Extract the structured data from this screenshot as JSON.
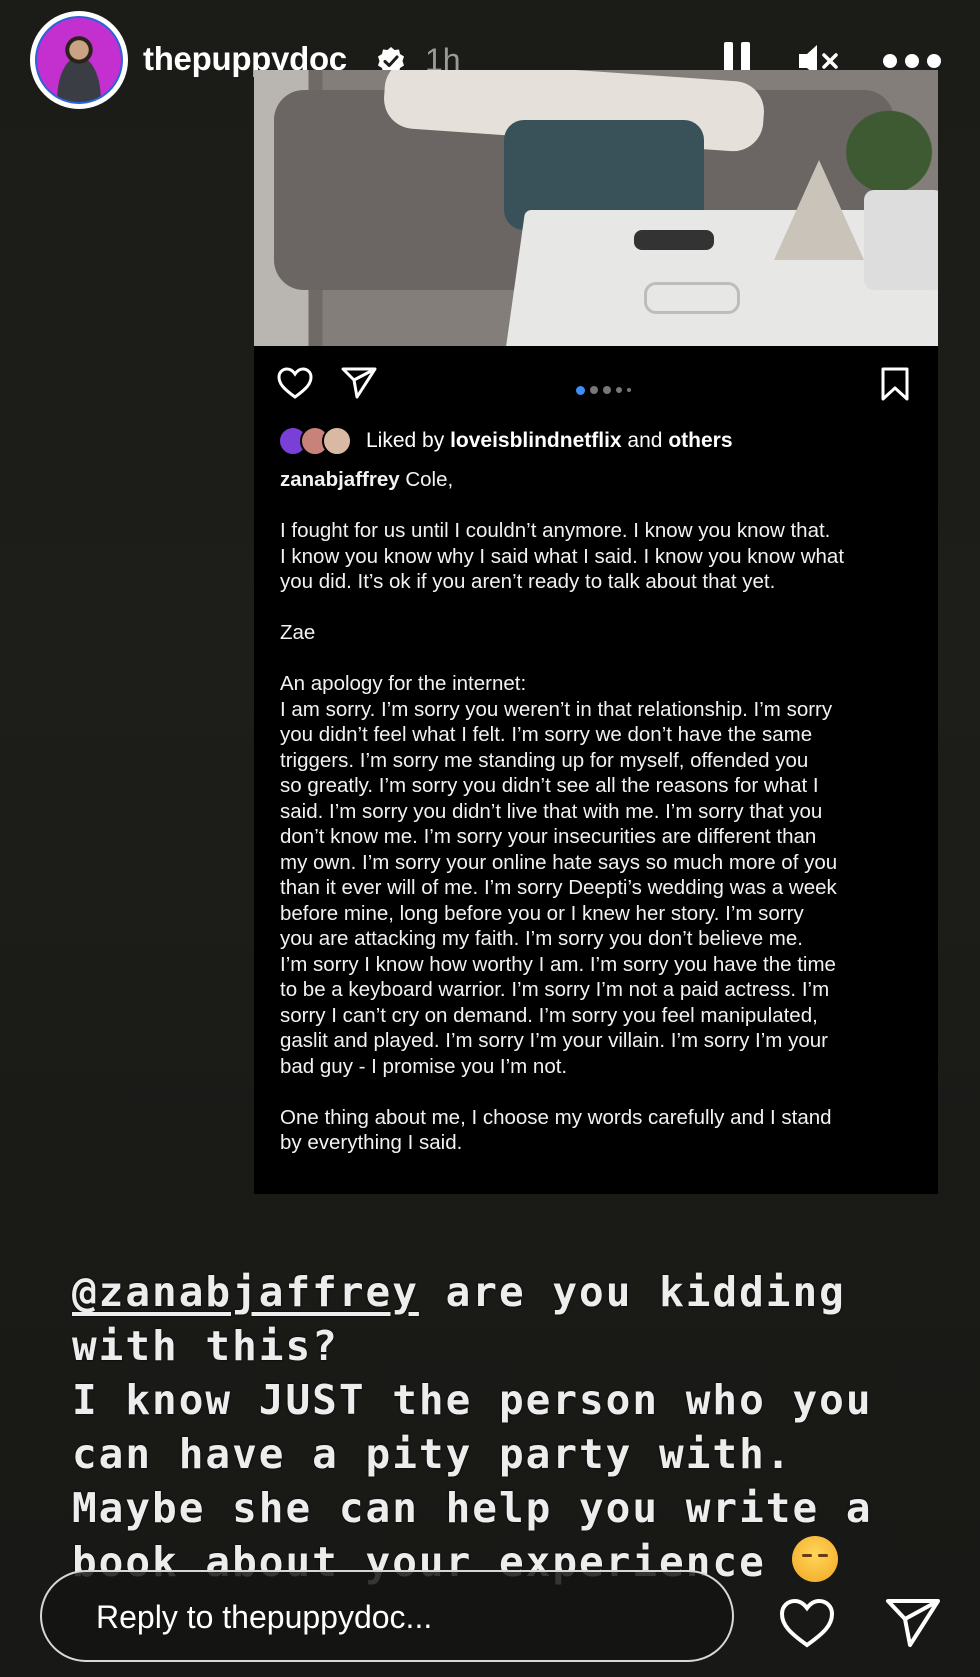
{
  "header": {
    "username": "thepuppydoc",
    "time_ago": "1h",
    "icons": [
      "verified-badge-icon",
      "pause-icon",
      "mute-icon",
      "more-icon"
    ]
  },
  "post": {
    "likes": {
      "prefix": "Liked by ",
      "user": "loveisblindnetflix",
      "middle": " and ",
      "others": "others"
    },
    "carousel": {
      "count": 5,
      "active": 1
    },
    "caption": {
      "author": "zanabjaffrey",
      "lines": [
        "Cole,",
        "",
        "I fought for us until I couldn’t anymore. I know you know that.",
        "I know you know why I said what I said. I know you know what",
        "you did. It’s ok if you aren’t ready to talk about that yet.",
        "",
        "Zae",
        "",
        "An apology for the internet:",
        "I am sorry. I’m sorry you weren’t in that relationship. I’m sorry",
        "you didn’t feel what I felt. I’m sorry we don’t have the same",
        "triggers. I’m sorry me standing up for myself, offended you",
        "so greatly. I’m sorry you didn’t see all the reasons for what I",
        "said. I’m sorry you didn’t live that with me. I’m sorry that you",
        "don’t know me. I’m sorry your insecurities are different than",
        "my own. I’m sorry your online hate says so much more of you",
        "than it ever will of me. I’m sorry Deepti’s wedding was a week",
        "before mine, long before you or I knew her story. I’m sorry",
        "you are attacking my faith. I’m sorry you don’t believe me.",
        "I’m sorry I know how worthy I am. I’m sorry you have the time",
        "to be a keyboard warrior. I’m sorry I’m not a paid actress. I’m",
        "sorry I can’t cry on demand. I’m sorry you feel manipulated,",
        "gaslit and played. I’m sorry I’m your villain. I’m sorry I’m your",
        "bad guy - I promise you I’m not.",
        "",
        "One thing about me, I choose my words carefully and I stand",
        "by everything I said."
      ]
    }
  },
  "story_text": {
    "mention": "@zanabjaffrey",
    "line1_rest": " are you kidding",
    "line2": "with this?",
    "line3": "I know JUST the person who you",
    "line4": "can have a pity party with.",
    "line5": "Maybe she can help you write a",
    "line6": "book about your experience"
  },
  "reply": {
    "placeholder": "Reply to thepuppydoc..."
  },
  "colors": {
    "avatar_bg": "#c42fcf",
    "background": "#1b1c18",
    "post_bg": "#000000",
    "carousel_active": "#3d8ef7"
  }
}
